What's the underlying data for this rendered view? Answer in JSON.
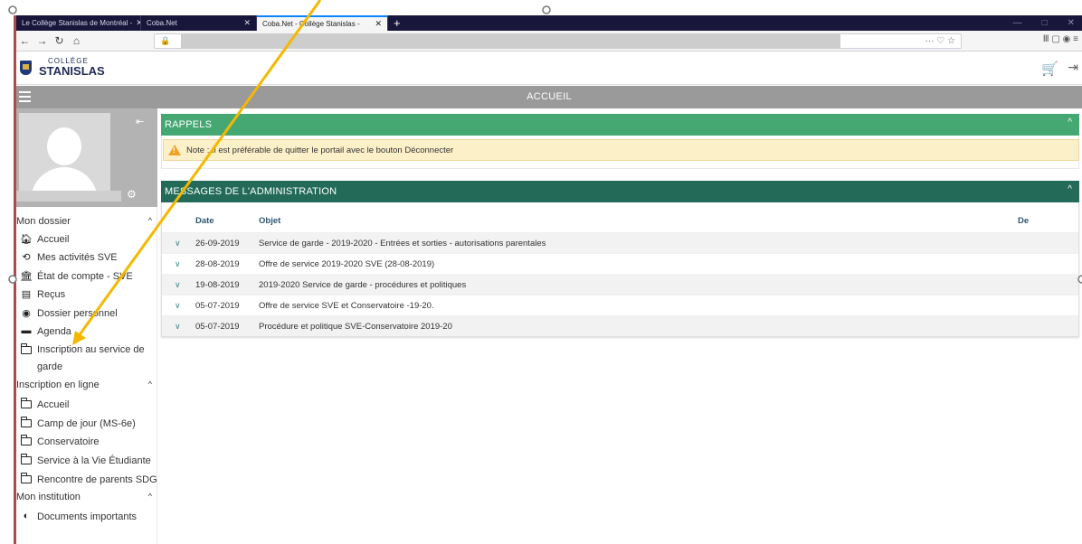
{
  "browser": {
    "tabs": [
      {
        "title": "Le Collège Stanislas de Montréal -",
        "close": "✕"
      },
      {
        "title": "Coba.Net",
        "close": "✕"
      },
      {
        "title": "Coba.Net - Collège Stanislas -",
        "close": "✕"
      }
    ],
    "new_tab": "+",
    "window_controls": [
      "—",
      "□",
      "✕"
    ],
    "url_tools": "··· ♡ ☆",
    "right_tools": "Ⅲ ▢ ◉ ≡"
  },
  "header": {
    "logo_line1": "COLLÈGE",
    "logo_line2": "STANISLAS",
    "cart_icon": "🛒",
    "exit_icon": "⇥"
  },
  "titlebar": {
    "title": "ACCUEIL"
  },
  "sidebar": {
    "collapse_icon": "⇤",
    "gear_icon": "⚙",
    "sections": [
      {
        "label": "Mon dossier",
        "items": [
          {
            "label": "Accueil",
            "icon": "home-icon"
          },
          {
            "label": "Mes activités SVE",
            "icon": "history-icon"
          },
          {
            "label": "État de compte - SVE",
            "icon": "bank-icon"
          },
          {
            "label": "Reçus",
            "icon": "receipt-icon"
          },
          {
            "label": "Dossier personnel",
            "icon": "user-circle-icon"
          },
          {
            "label": "Agenda",
            "icon": "agenda-icon"
          },
          {
            "label": "Inscription au service de garde",
            "icon": "folder-icon"
          }
        ]
      },
      {
        "label": "Inscription en ligne",
        "items": [
          {
            "label": "Accueil",
            "icon": "folder-icon"
          },
          {
            "label": "Camp de jour (MS-6e)",
            "icon": "folder-icon"
          },
          {
            "label": "Conservatoire",
            "icon": "folder-icon"
          },
          {
            "label": "Service à la Vie Étudiante",
            "icon": "folder-icon"
          },
          {
            "label": "Rencontre de parents SDG",
            "icon": "folder-icon"
          }
        ]
      },
      {
        "label": "Mon institution",
        "items": [
          {
            "label": "Documents importants",
            "icon": "globe-icon"
          }
        ]
      }
    ]
  },
  "rappels": {
    "title": "RAPPELS",
    "note": "Note : Il est préférable de quitter le portail avec le bouton Déconnecter"
  },
  "messages": {
    "title": "MESSAGES DE L'ADMINISTRATION",
    "columns": {
      "date": "Date",
      "objet": "Objet",
      "de": "De"
    },
    "rows": [
      {
        "date": "26-09-2019",
        "objet": "Service de garde - 2019-2020 - Entrées et sorties - autorisations parentales"
      },
      {
        "date": "28-08-2019",
        "objet": "Offre de service 2019-2020 SVE (28-08-2019)"
      },
      {
        "date": "19-08-2019",
        "objet": "2019-2020 Service de garde - procédures et politiques"
      },
      {
        "date": "05-07-2019",
        "objet": "Offre de service SVE et Conservatoire -19-20."
      },
      {
        "date": "05-07-2019",
        "objet": "Procédure et politique SVE-Conservatoire 2019-20"
      }
    ]
  },
  "colors": {
    "rappels_header": "#45a772",
    "messages_header": "#236b58",
    "titlebar": "#9a9a9a",
    "annotation_arrow": "#f5b800",
    "note_bg": "#fcf0c8"
  }
}
